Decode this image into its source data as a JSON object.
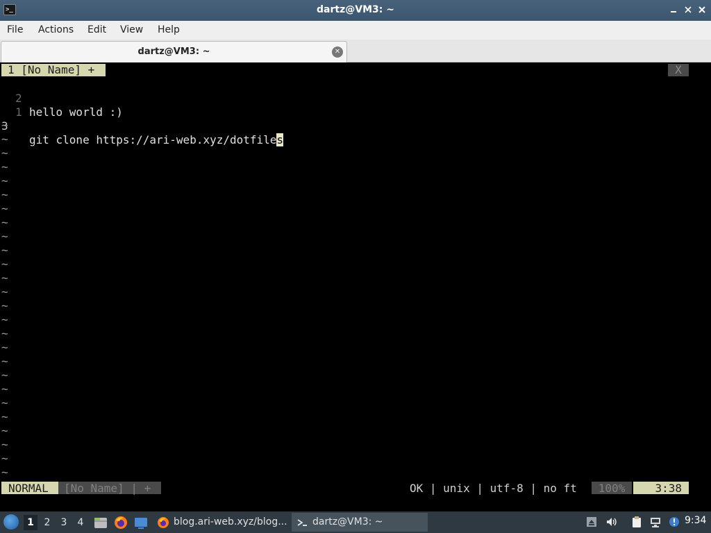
{
  "window": {
    "title": "dartz@VM3: ~",
    "app_icon": ">_",
    "buttons": [
      "minimize-icon",
      "restore-icon",
      "close-icon"
    ]
  },
  "menu": {
    "items": [
      "File",
      "Actions",
      "Edit",
      "View",
      "Help"
    ]
  },
  "tab": {
    "label": "dartz@VM3: ~",
    "close_icon": "close-icon"
  },
  "vim": {
    "tabline": {
      "current": "1 [No Name] +",
      "close": "X"
    },
    "lines": [
      {
        "number": "2",
        "text": "hello world :)"
      },
      {
        "number": "1",
        "text": ""
      },
      {
        "number": "3",
        "text": "git clone https://ari-web.xyz/dotfile",
        "cursor_char": "s"
      }
    ],
    "tilde": "~",
    "status": {
      "mode": "NORMAL",
      "file": "[No Name] | +",
      "info": "OK | unix | utf-8 | no ft",
      "percent": "100%",
      "position": "3:38"
    }
  },
  "taskbar": {
    "workspaces": [
      "1",
      "2",
      "3",
      "4"
    ],
    "active_workspace": "1",
    "quicklaunch": [
      "file-manager-icon",
      "firefox-icon",
      "desktop-icon"
    ],
    "tasks": [
      {
        "label": "blog.ari-web.xyz/blog...",
        "icon": "firefox-icon"
      },
      {
        "label": "dartz@VM3: ~",
        "icon": "terminal-icon"
      }
    ],
    "tray": [
      "eject-icon",
      "volume-icon",
      "clipboard-icon",
      "network-icon",
      "notifications-icon"
    ],
    "clock": "9:34"
  },
  "colors": {
    "titlebar": "#3c5670",
    "vim_accent": "#d7d7af",
    "vim_dim": "#4a4a4a",
    "taskbar": "#2e3942"
  }
}
